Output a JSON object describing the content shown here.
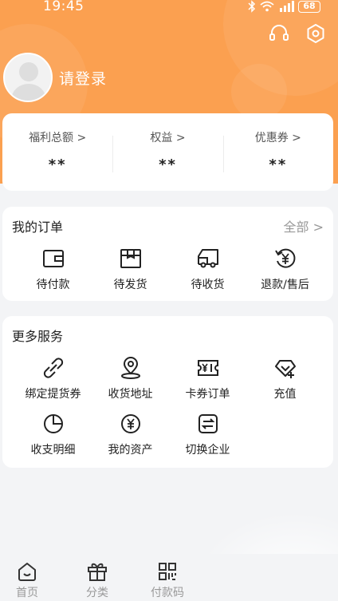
{
  "status_bar": {
    "time": "19:45",
    "battery": "68"
  },
  "header": {
    "login_text": "请登录",
    "actions": [
      {
        "icon": "headset-icon"
      },
      {
        "icon": "settings-icon"
      }
    ]
  },
  "stats": [
    {
      "label": "福利总额 >",
      "value": "**"
    },
    {
      "label": "权益 >",
      "value": "**"
    },
    {
      "label": "优惠券 >",
      "value": "**"
    }
  ],
  "orders": {
    "title": "我的订单",
    "more": "全部 >",
    "items": [
      {
        "label": "待付款",
        "icon": "wallet-icon"
      },
      {
        "label": "待发货",
        "icon": "box-icon"
      },
      {
        "label": "待收货",
        "icon": "truck-icon"
      },
      {
        "label": "退款/售后",
        "icon": "refund-icon"
      }
    ]
  },
  "services": {
    "title": "更多服务",
    "items": [
      {
        "label": "绑定提货券",
        "icon": "link-icon"
      },
      {
        "label": "收货地址",
        "icon": "location-icon"
      },
      {
        "label": "卡券订单",
        "icon": "ticket-icon"
      },
      {
        "label": "充值",
        "icon": "topup-icon"
      },
      {
        "label": "收支明细",
        "icon": "pie-chart-icon"
      },
      {
        "label": "我的资产",
        "icon": "yuan-icon"
      },
      {
        "label": "切换企业",
        "icon": "switch-icon"
      }
    ]
  },
  "tabbar": [
    {
      "label": "首页",
      "icon": "home-icon"
    },
    {
      "label": "分类",
      "icon": "gift-icon"
    },
    {
      "label": "付款码",
      "icon": "qr-code-icon"
    }
  ],
  "colors": {
    "brand": "#fba050",
    "card": "#ffffff",
    "background": "#f3f4f6"
  }
}
